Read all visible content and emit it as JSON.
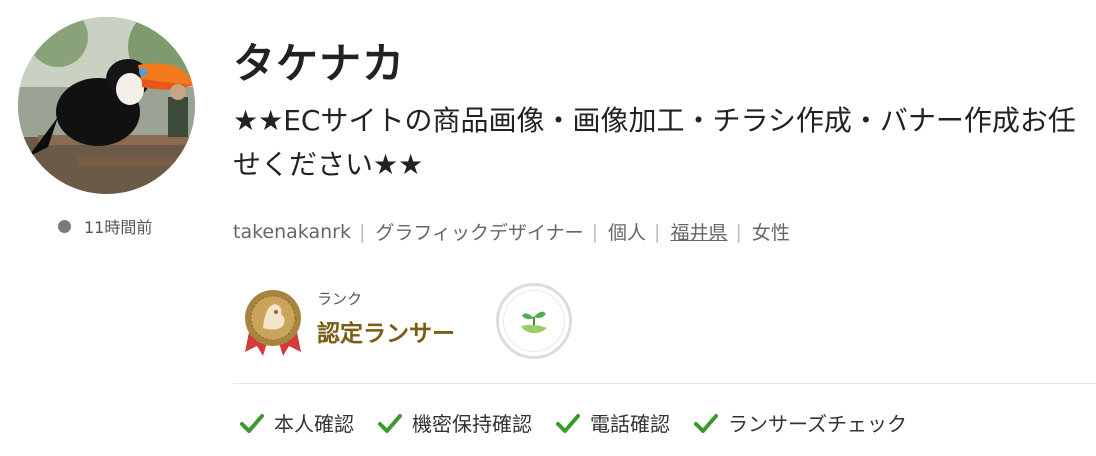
{
  "profile": {
    "name": "タケナカ",
    "catchphrase": "★★ECサイトの商品画像・画像加工・チラシ作成・バナー作成お任せください★★",
    "last_active": "11時間前",
    "meta": {
      "username": "takenakanrk",
      "occupation": "グラフィックデザイナー",
      "type": "個人",
      "location": "福井県",
      "gender": "女性"
    }
  },
  "rank": {
    "label": "ランク",
    "value": "認定ランサー",
    "badge_icon": "certified-medal-icon",
    "secondary_badge_icon": "sprout-badge-icon"
  },
  "verifications": [
    {
      "label": "本人確認",
      "icon": "check-icon"
    },
    {
      "label": "機密保持確認",
      "icon": "check-icon"
    },
    {
      "label": "電話確認",
      "icon": "check-icon"
    },
    {
      "label": "ランサーズチェック",
      "icon": "check-icon"
    }
  ],
  "colors": {
    "rank_text": "#7b5c14",
    "check": "#3a9b2c",
    "online_dot": "#7b7b7b",
    "sprout": "#4caf50"
  }
}
